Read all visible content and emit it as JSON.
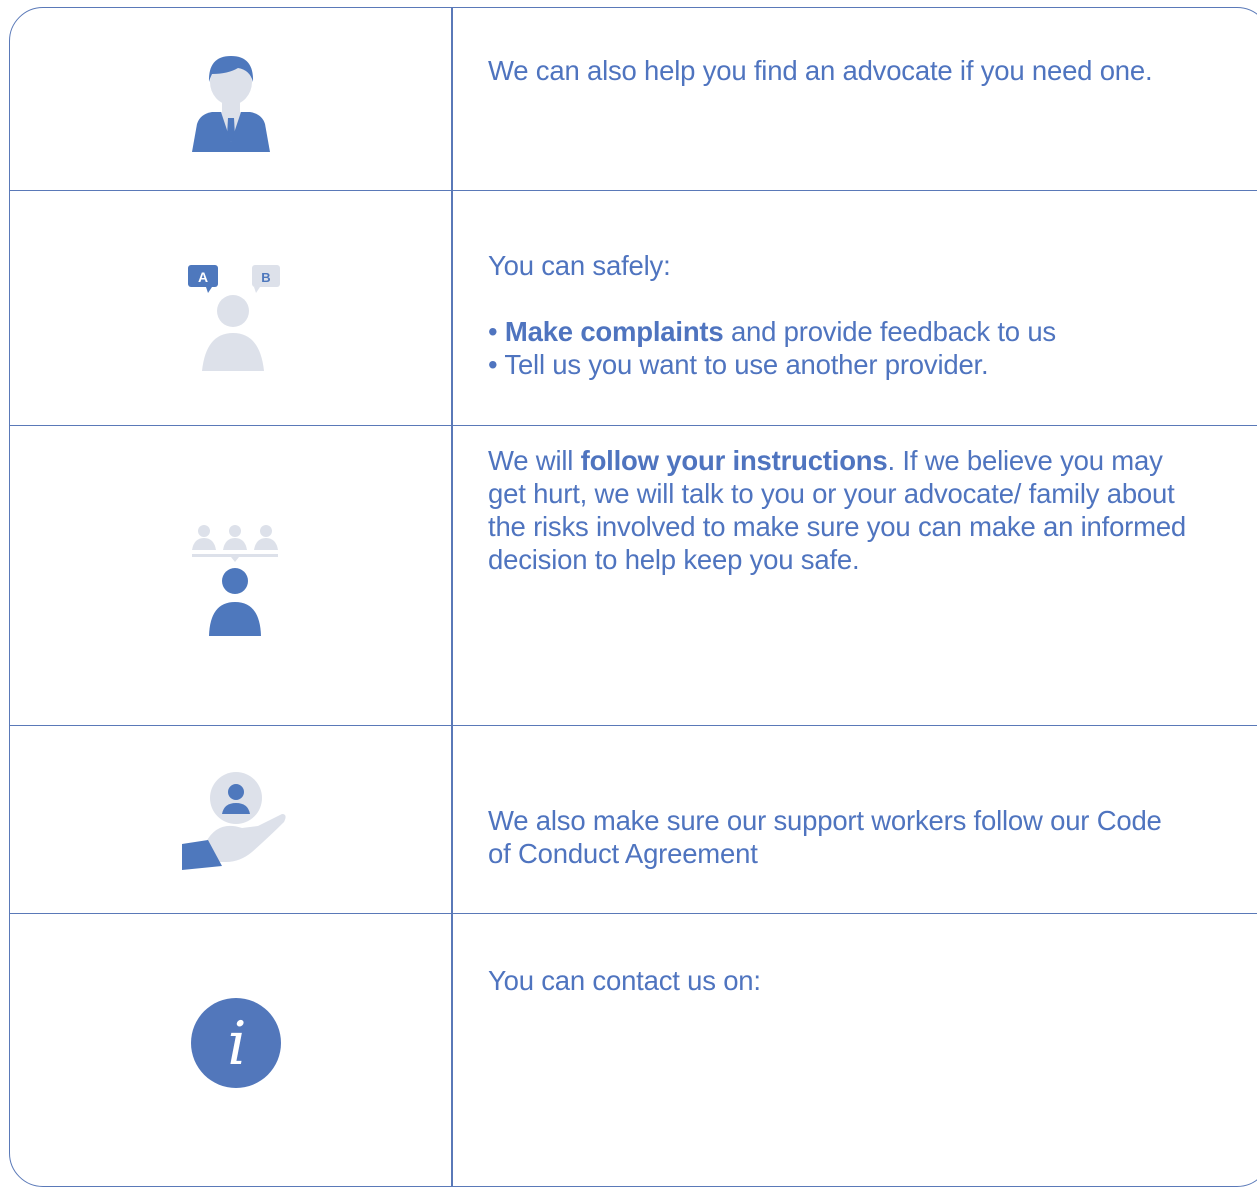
{
  "rows": [
    {
      "icon": "advocate-person-icon",
      "text": "We can also help you find an advocate if you need one."
    },
    {
      "icon": "person-speech-choice-icon",
      "icon_labels": [
        "A",
        "B"
      ],
      "intro": "You can safely:",
      "bullets": [
        {
          "bullet": "•",
          "bold": "Make complaints",
          "rest": " and provide feedback to us"
        },
        {
          "bullet": "•",
          "bold": "",
          "rest": "Tell us you want to use another provider."
        }
      ]
    },
    {
      "icon": "group-instructions-icon",
      "pre": "We will ",
      "bold": "follow your instructions",
      "post": ". If we believe you may get hurt, we will talk to you or your advocate/ family about the risks involved to make sure you can make an informed decision to help keep you safe."
    },
    {
      "icon": "hand-support-person-icon",
      "text": "We also make sure our support workers follow our Code of Conduct Agreement"
    },
    {
      "icon": "information-icon",
      "icon_glyph": "i",
      "text": "You can contact us on:"
    }
  ],
  "colors": {
    "primary": "#4f74bf",
    "icon_dark": "#4e78bd",
    "icon_light": "#dde1ea",
    "border": "#5a79b8"
  }
}
